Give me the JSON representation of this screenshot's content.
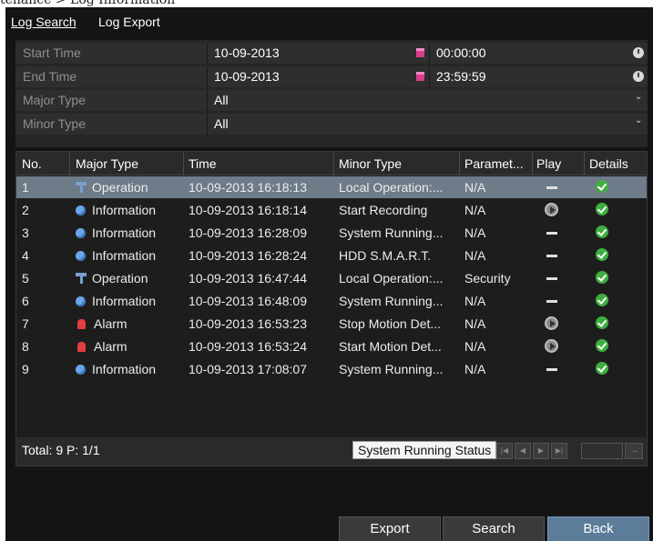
{
  "caption": "tenance > Log Information",
  "tabs": [
    {
      "label": "Log Search",
      "active": true
    },
    {
      "label": "Log Export",
      "active": false
    }
  ],
  "form": {
    "start_time": {
      "label": "Start Time",
      "date": "10-09-2013",
      "time": "00:00:00"
    },
    "end_time": {
      "label": "End Time",
      "date": "10-09-2013",
      "time": "23:59:59"
    },
    "major_type": {
      "label": "Major Type",
      "value": "All"
    },
    "minor_type": {
      "label": "Minor Type",
      "value": "All"
    }
  },
  "table": {
    "headers": [
      "No.",
      "Major Type",
      "Time",
      "Minor Type",
      "Paramet...",
      "Play",
      "Details"
    ],
    "rows": [
      {
        "no": "1",
        "major": "Operation",
        "major_icon": "operation-icon",
        "time": "10-09-2013 16:18:13",
        "minor": "Local Operation:...",
        "param": "N/A",
        "play": "none",
        "selected": true
      },
      {
        "no": "2",
        "major": "Information",
        "major_icon": "information-icon",
        "time": "10-09-2013 16:18:14",
        "minor": "Start Recording",
        "param": "N/A",
        "play": "play"
      },
      {
        "no": "3",
        "major": "Information",
        "major_icon": "information-icon",
        "time": "10-09-2013 16:28:09",
        "minor": "System Running...",
        "param": "N/A",
        "play": "none"
      },
      {
        "no": "4",
        "major": "Information",
        "major_icon": "information-icon",
        "time": "10-09-2013 16:28:24",
        "minor": "HDD S.M.A.R.T.",
        "param": "N/A",
        "play": "none"
      },
      {
        "no": "5",
        "major": "Operation",
        "major_icon": "operation-icon",
        "time": "10-09-2013 16:47:44",
        "minor": "Local Operation:...",
        "param": "Security",
        "play": "none"
      },
      {
        "no": "6",
        "major": "Information",
        "major_icon": "information-icon",
        "time": "10-09-2013 16:48:09",
        "minor": "System Running...",
        "param": "N/A",
        "play": "none"
      },
      {
        "no": "7",
        "major": "Alarm",
        "major_icon": "alarm-icon",
        "time": "10-09-2013 16:53:23",
        "minor": "Stop Motion Det...",
        "param": "N/A",
        "play": "play"
      },
      {
        "no": "8",
        "major": "Alarm",
        "major_icon": "alarm-icon",
        "time": "10-09-2013 16:53:24",
        "minor": "Start Motion Det...",
        "param": "N/A",
        "play": "play"
      },
      {
        "no": "9",
        "major": "Information",
        "major_icon": "information-icon",
        "time": "10-09-2013 17:08:07",
        "minor": "System Running...",
        "param": "N/A",
        "play": "none"
      }
    ],
    "tooltip": "System Running Status",
    "footer": {
      "total": "Total: 9  P: 1/1",
      "page_input": ""
    }
  },
  "buttons": {
    "export": "Export",
    "search": "Search",
    "back": "Back"
  },
  "colors": {
    "background": "#141414",
    "selected_row": "#6e7b88",
    "primary_button": "#5c7c99",
    "check": "#3fae3f"
  }
}
